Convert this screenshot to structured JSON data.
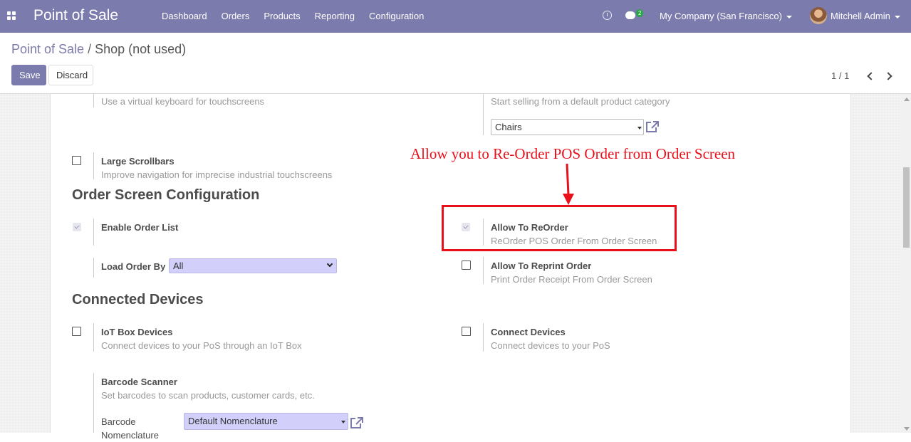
{
  "navbar": {
    "brand": "Point of Sale",
    "menu": [
      "Dashboard",
      "Orders",
      "Products",
      "Reporting",
      "Configuration"
    ],
    "chat_count": "2",
    "company": "My Company (San Francisco)",
    "user": "Mitchell Admin",
    "color": "#7c7bad"
  },
  "breadcrumb": {
    "parent": "Point of Sale",
    "separator": "/",
    "current": "Shop (not used)"
  },
  "actions": {
    "save": "Save",
    "discard": "Discard"
  },
  "pager": {
    "value": "1 / 1"
  },
  "settings": {
    "virtual_keyboard_desc": "Use a virtual keyboard for touchscreens",
    "default_category_desc": "Start selling from a default product category",
    "default_category_value": "Chairs",
    "large_scrollbars": {
      "title": "Large Scrollbars",
      "desc": "Improve navigation for imprecise industrial touchscreens",
      "checked": false
    }
  },
  "order_screen": {
    "section_title": "Order Screen Configuration",
    "enable_order_list": {
      "title": "Enable Order List",
      "checked": true
    },
    "load_order_by": {
      "label": "Load Order By",
      "value": "All"
    },
    "allow_reorder": {
      "title": "Allow To ReOrder",
      "desc": "ReOrder POS Order From Order Screen",
      "checked": true
    },
    "allow_reprint": {
      "title": "Allow To Reprint Order",
      "desc": "Print Order Receipt From Order Screen",
      "checked": false
    }
  },
  "connected_devices": {
    "section_title": "Connected Devices",
    "iot_box": {
      "title": "IoT Box Devices",
      "desc": "Connect devices to your PoS through an IoT Box",
      "checked": false
    },
    "connect_devices": {
      "title": "Connect Devices",
      "desc": "Connect devices to your PoS",
      "checked": false
    },
    "barcode_scanner": {
      "title": "Barcode Scanner",
      "desc": "Set barcodes to scan products, customer cards, etc."
    },
    "barcode_nomenclature": {
      "label": "Barcode Nomenclature",
      "value": "Default Nomenclature"
    }
  },
  "annotation": {
    "text": "Allow you to Re-Order POS Order from Order Screen",
    "color": "#e8101b"
  }
}
